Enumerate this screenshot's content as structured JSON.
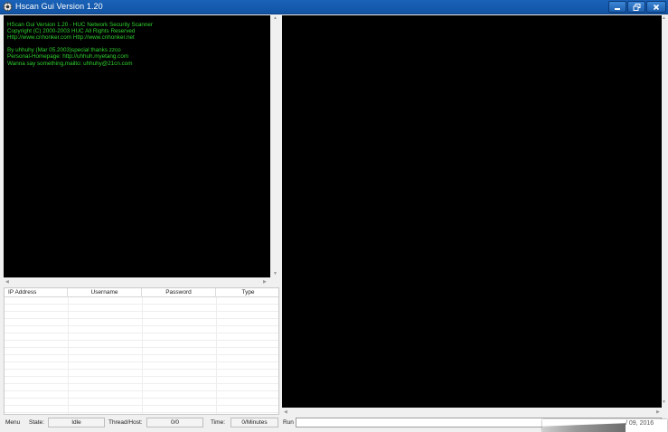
{
  "window": {
    "title": "Hscan Gui Version 1.20",
    "title_bar_color": "#1a63b8"
  },
  "left_console": {
    "text_color": "#2fd42f",
    "lines": [
      "HScan Gui Version 1.20 - HUC Network Security Scanner",
      "Copyright (C) 2000-2003 HUC All Rights Reserved",
      "Http://www.cnhonker.com Http://www.cnhonker.net",
      "",
      "By uhhuhy (Mar 05.2003)special thanks zzco",
      "Personal-Homepage: http://uhhuh.myetang.com",
      "Wanna say something,mailto: uhhuhy@21cn.com"
    ]
  },
  "table": {
    "columns": [
      "IP Address",
      "Username",
      "Password",
      "Type"
    ],
    "rows": []
  },
  "statusbar": {
    "menu": "Menu",
    "state_label": "State:",
    "state_value": "Idle",
    "thread_label": "Thread/Host:",
    "thread_value": "0/0",
    "time_label": "Time:",
    "time_value": "0/Minutes",
    "run_label": "Run"
  },
  "popup": {
    "date_text": "/ 09, 2016"
  }
}
